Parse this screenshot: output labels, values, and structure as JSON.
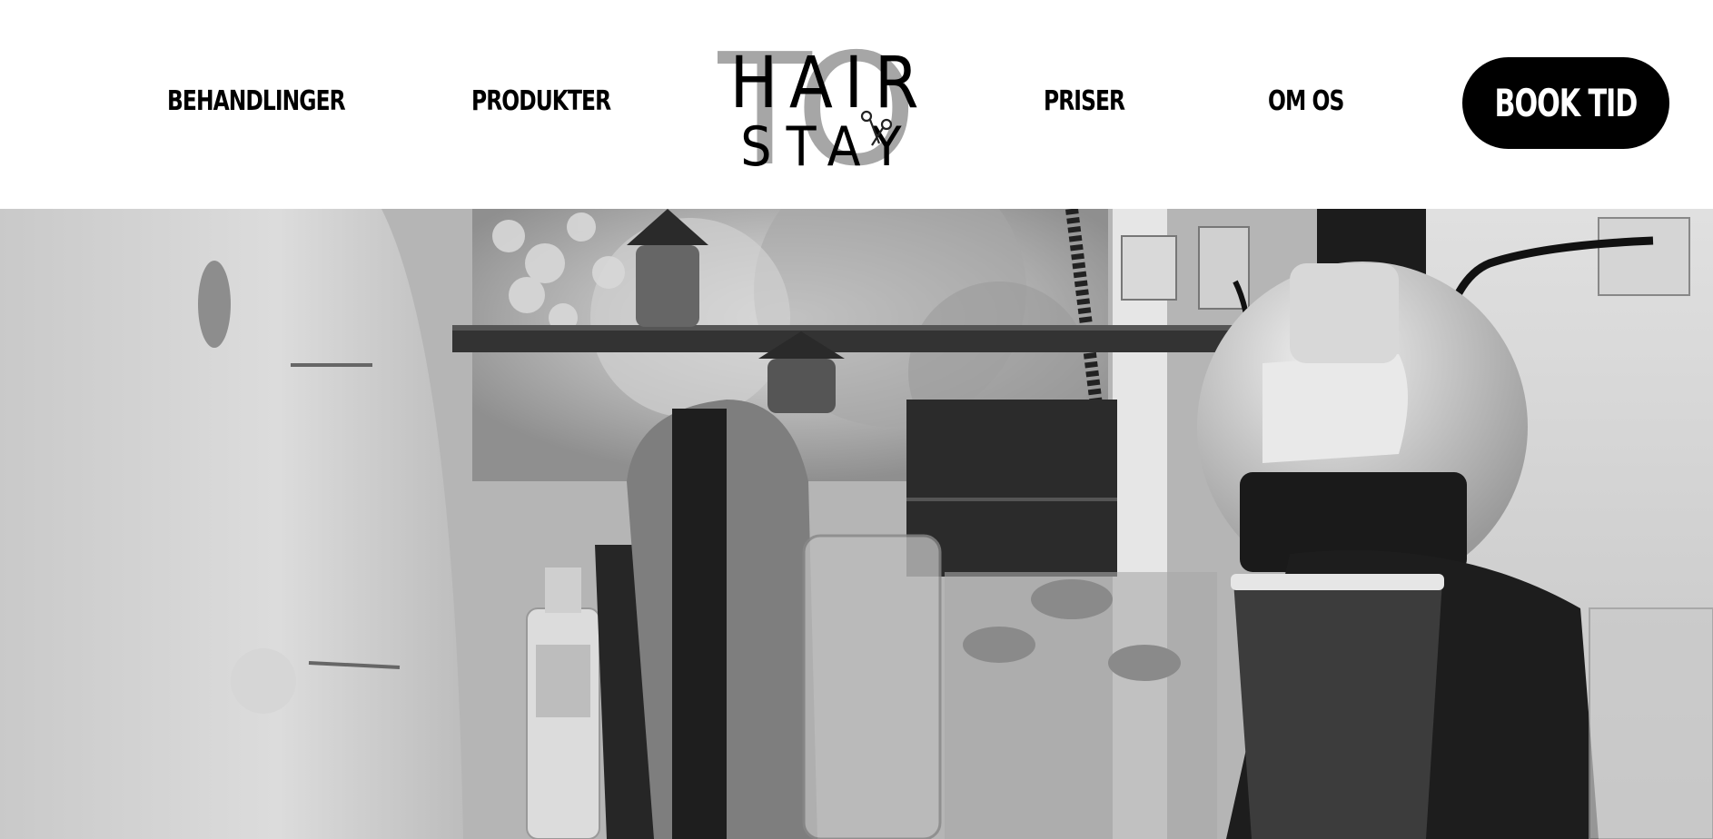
{
  "nav": {
    "left": [
      {
        "label": "BEHANDLINGER"
      },
      {
        "label": "PRODUKTER"
      }
    ],
    "right": [
      {
        "label": "PRISER"
      },
      {
        "label": "OM OS"
      }
    ],
    "cta_label": "BOOK TID"
  },
  "logo": {
    "line1": "HAIR",
    "line2": "STAY",
    "overlay": "TO",
    "icon": "scissors-icon"
  },
  "hero": {
    "description_icon": "salon-photo",
    "colors": {
      "dark": "#1a1a1a",
      "mid": "#7d7d7d",
      "light": "#e2e2e2"
    }
  }
}
